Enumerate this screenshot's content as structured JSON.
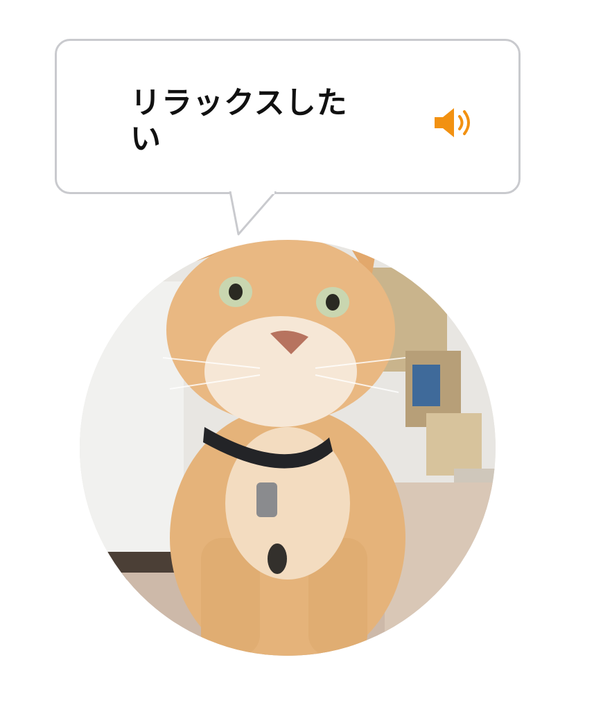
{
  "bubble": {
    "text": "リラックスしたい",
    "speaker_icon": "speaker-sound-icon",
    "speaker_color": "#f29111",
    "border_color": "#c9cace"
  },
  "photo": {
    "subject": "orange-tabby-cat-photo"
  }
}
